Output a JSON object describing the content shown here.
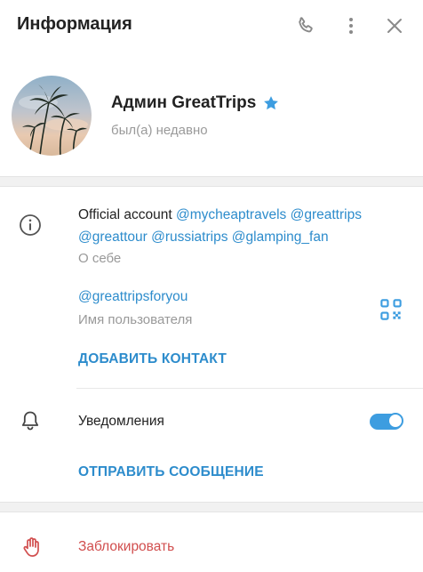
{
  "header": {
    "title": "Информация",
    "icons": [
      "phone-icon",
      "more-vertical-icon",
      "close-icon"
    ]
  },
  "profile": {
    "name": "Админ GreatTrips",
    "status": "был(а) недавно",
    "verified_icon": "star-icon"
  },
  "about": {
    "text_prefix": "Official account ",
    "mentions": [
      "@mycheaptravels",
      "@greattrips",
      "@greattour",
      "@russiatrips",
      "@glamping_fan"
    ],
    "caption": "О себе"
  },
  "username": {
    "value": "@greattripsforyou",
    "caption": "Имя пользователя",
    "qr_icon": "qr-code-icon"
  },
  "actions": {
    "add_contact": "ДОБАВИТЬ КОНТАКТ",
    "send_message": "ОТПРАВИТЬ СООБЩЕНИЕ",
    "block": "Заблокировать"
  },
  "notifications": {
    "label": "Уведомления",
    "enabled": true
  },
  "colors": {
    "accent": "#2d8ccc",
    "danger": "#d14e4e",
    "toggle": "#3d9de0"
  }
}
